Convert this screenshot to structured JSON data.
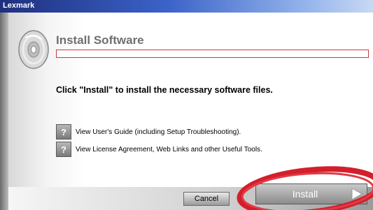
{
  "window": {
    "title": "Lexmark"
  },
  "header": {
    "title": "Install Software"
  },
  "main": {
    "instruction": "Click \"Install\" to install the necessary software files.",
    "help_items": [
      {
        "icon": "help-icon",
        "label": "View User's Guide (including Setup Troubleshooting)."
      },
      {
        "icon": "help-icon",
        "label": "View License Agreement, Web Links and other Useful Tools."
      }
    ]
  },
  "buttons": {
    "cancel": "Cancel",
    "install": "Install"
  },
  "colors": {
    "titlebar": "#1f2f7f",
    "divider_border": "#cc3a3a",
    "highlight_ellipse": "#d31f2b"
  }
}
